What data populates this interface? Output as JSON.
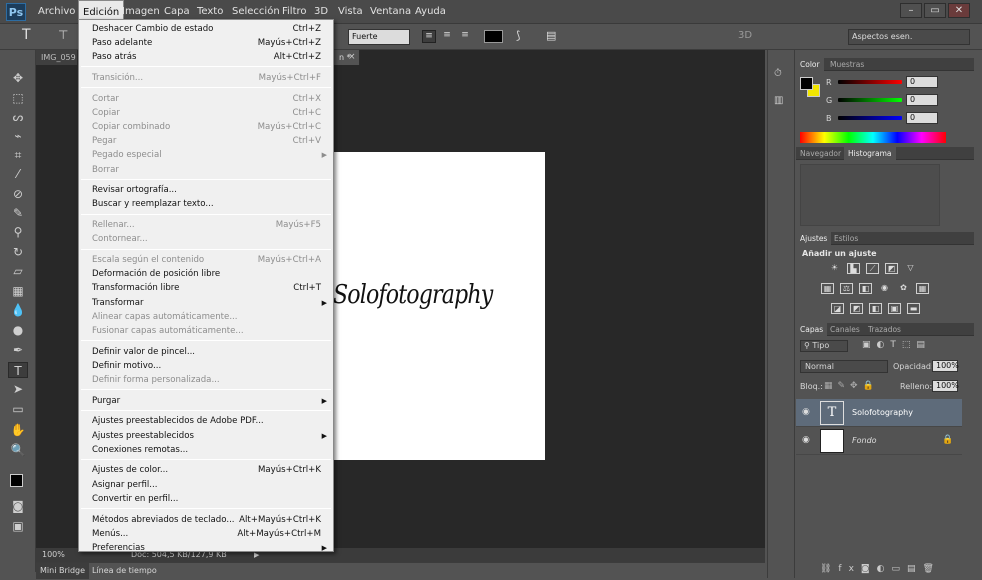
{
  "app": {
    "logo": "Ps"
  },
  "menubar": [
    "Archivo",
    "Edición",
    "Imagen",
    "Capa",
    "Texto",
    "Selección",
    "Filtro",
    "3D",
    "Vista",
    "Ventana",
    "Ayuda"
  ],
  "window_controls": {
    "minimize": "–",
    "restore": "▭",
    "close": "✕"
  },
  "options": {
    "tool_glyph": "T",
    "font_style": "Fuerte",
    "mode_3d": "3D",
    "workspace": "Aspectos esen."
  },
  "document": {
    "tab1": "IMG_059",
    "tab2_suffix": "n *",
    "tab_close": "×",
    "canvas_text": "Solofotography",
    "zoom": "100%",
    "doc_info": "Doc: 504,5 KB/127,9 KB"
  },
  "bottom_tabs": [
    "Mini Bridge",
    "Línea de tiempo"
  ],
  "edit_menu": [
    {
      "label": "Deshacer Cambio de estado",
      "shortcut": "Ctrl+Z",
      "enabled": true
    },
    {
      "label": "Paso adelante",
      "shortcut": "Mayús+Ctrl+Z",
      "enabled": true
    },
    {
      "label": "Paso atrás",
      "shortcut": "Alt+Ctrl+Z",
      "enabled": true
    },
    {
      "sep": true
    },
    {
      "label": "Transición...",
      "shortcut": "Mayús+Ctrl+F",
      "enabled": false
    },
    {
      "sep": true
    },
    {
      "label": "Cortar",
      "shortcut": "Ctrl+X",
      "enabled": false
    },
    {
      "label": "Copiar",
      "shortcut": "Ctrl+C",
      "enabled": false
    },
    {
      "label": "Copiar combinado",
      "shortcut": "Mayús+Ctrl+C",
      "enabled": false
    },
    {
      "label": "Pegar",
      "shortcut": "Ctrl+V",
      "enabled": false
    },
    {
      "label": "Pegado especial",
      "shortcut": "",
      "enabled": false,
      "submenu": true
    },
    {
      "label": "Borrar",
      "shortcut": "",
      "enabled": false
    },
    {
      "sep": true
    },
    {
      "label": "Revisar ortografía...",
      "shortcut": "",
      "enabled": true
    },
    {
      "label": "Buscar y reemplazar texto...",
      "shortcut": "",
      "enabled": true
    },
    {
      "sep": true
    },
    {
      "label": "Rellenar...",
      "shortcut": "Mayús+F5",
      "enabled": false
    },
    {
      "label": "Contornear...",
      "shortcut": "",
      "enabled": false
    },
    {
      "sep": true
    },
    {
      "label": "Escala según el contenido",
      "shortcut": "Mayús+Ctrl+A",
      "enabled": false
    },
    {
      "label": "Deformación de posición libre",
      "shortcut": "",
      "enabled": true
    },
    {
      "label": "Transformación libre",
      "shortcut": "Ctrl+T",
      "enabled": true
    },
    {
      "label": "Transformar",
      "shortcut": "",
      "enabled": true,
      "submenu": true
    },
    {
      "label": "Alinear capas automáticamente...",
      "shortcut": "",
      "enabled": false
    },
    {
      "label": "Fusionar capas automáticamente...",
      "shortcut": "",
      "enabled": false
    },
    {
      "sep": true
    },
    {
      "label": "Definir valor de pincel...",
      "shortcut": "",
      "enabled": true
    },
    {
      "label": "Definir motivo...",
      "shortcut": "",
      "enabled": true
    },
    {
      "label": "Definir forma personalizada...",
      "shortcut": "",
      "enabled": false
    },
    {
      "sep": true
    },
    {
      "label": "Purgar",
      "shortcut": "",
      "enabled": true,
      "submenu": true
    },
    {
      "sep": true
    },
    {
      "label": "Ajustes preestablecidos de Adobe PDF...",
      "shortcut": "",
      "enabled": true
    },
    {
      "label": "Ajustes preestablecidos",
      "shortcut": "",
      "enabled": true,
      "submenu": true
    },
    {
      "label": "Conexiones remotas...",
      "shortcut": "",
      "enabled": true
    },
    {
      "sep": true
    },
    {
      "label": "Ajustes de color...",
      "shortcut": "Mayús+Ctrl+K",
      "enabled": true
    },
    {
      "label": "Asignar perfil...",
      "shortcut": "",
      "enabled": true
    },
    {
      "label": "Convertir en perfil...",
      "shortcut": "",
      "enabled": true
    },
    {
      "sep": true
    },
    {
      "label": "Métodos abreviados de teclado...",
      "shortcut": "Alt+Mayús+Ctrl+K",
      "enabled": true
    },
    {
      "label": "Menús...",
      "shortcut": "Alt+Mayús+Ctrl+M",
      "enabled": true
    },
    {
      "label": "Preferencias",
      "shortcut": "",
      "enabled": true,
      "submenu": true
    }
  ],
  "color_panel": {
    "tabs": [
      "Color",
      "Muestras"
    ],
    "channels": [
      {
        "name": "R",
        "value": "0"
      },
      {
        "name": "G",
        "value": "0"
      },
      {
        "name": "B",
        "value": "0"
      }
    ]
  },
  "nav_panel": {
    "tabs": [
      "Navegador",
      "Histograma"
    ]
  },
  "adjust_panel": {
    "tabs": [
      "Ajustes",
      "Estilos"
    ],
    "title": "Añadir un ajuste"
  },
  "layers_panel": {
    "tabs": [
      "Capas",
      "Canales",
      "Trazados"
    ],
    "filter": "Tipo",
    "blend": "Normal",
    "opacity_label": "Opacidad:",
    "opacity": "100%",
    "lock_label": "Bloq.:",
    "fill_label": "Relleno:",
    "fill": "100%",
    "layers": [
      {
        "name": "Solofotography",
        "thumb": "T"
      },
      {
        "name": "Fondo",
        "thumb": ""
      }
    ]
  },
  "colors": {
    "foreground": "#000000",
    "background": "#f2e600",
    "menu_bg": "#f0f0f0"
  }
}
